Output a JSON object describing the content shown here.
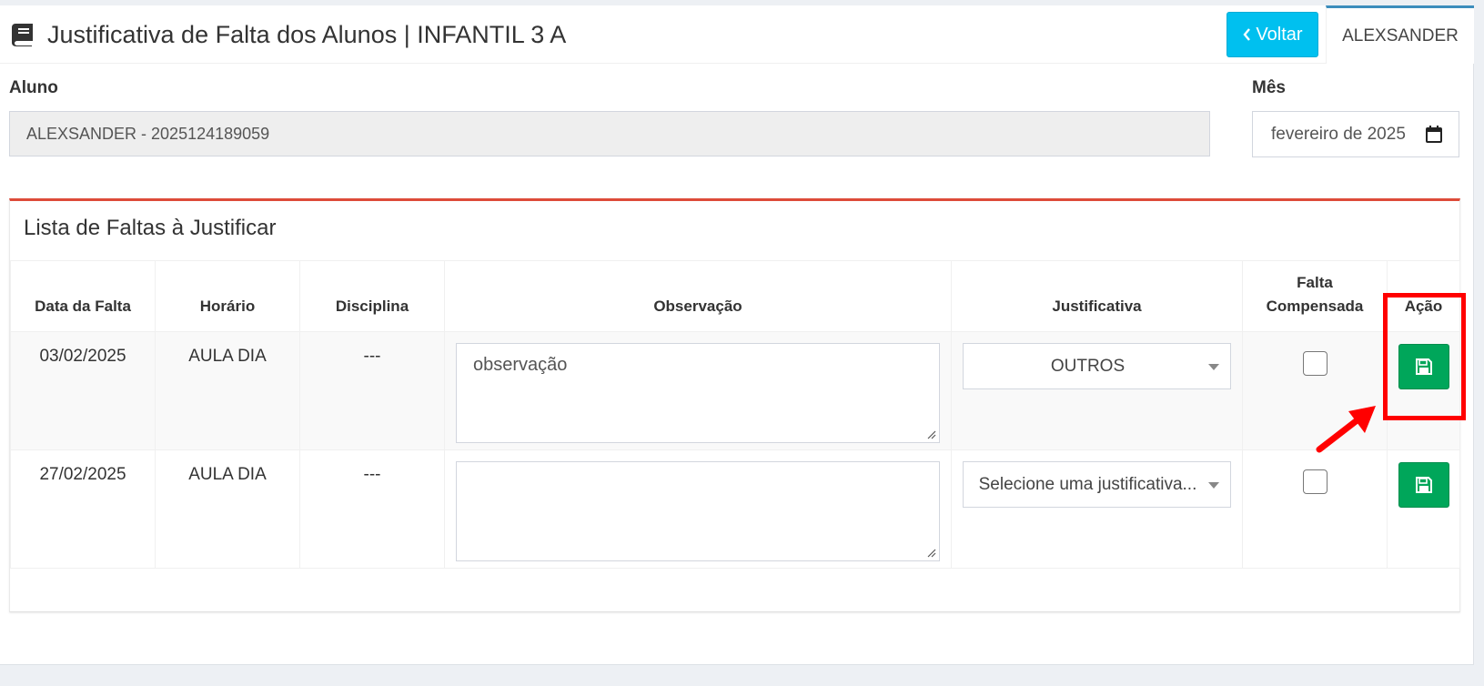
{
  "header": {
    "title": "Justificativa de Falta dos Alunos | INFANTIL 3 A",
    "title_icon": "book-icon",
    "back_button_label": "Voltar",
    "back_icon": "chevron-left-icon",
    "user_tab_label": "ALEXSANDER"
  },
  "form": {
    "aluno_label": "Aluno",
    "aluno_value": "ALEXSANDER - 2025124189059",
    "mes_label": "Mês",
    "mes_value": "fevereiro de 2025",
    "calendar_icon": "calendar-icon"
  },
  "box": {
    "title": "Lista de Faltas à Justificar",
    "accent_color": "#dd4b39"
  },
  "table": {
    "columns": [
      "Data da Falta",
      "Horário",
      "Disciplina",
      "Observação",
      "Justificativa",
      "Falta Compensada",
      "Ação"
    ],
    "rows": [
      {
        "data": "03/02/2025",
        "horario": "AULA DIA",
        "disciplina": "---",
        "observacao": "observação",
        "justificativa": "OUTROS",
        "compensada": false
      },
      {
        "data": "27/02/2025",
        "horario": "AULA DIA",
        "disciplina": "---",
        "observacao": "",
        "justificativa": "Selecione uma justificativa...",
        "compensada": false
      }
    ]
  },
  "colors": {
    "info_button": "#00c0ef",
    "success_button": "#00a65a",
    "annotation": "#ff0000",
    "tab_accent": "#3c8dbc"
  }
}
